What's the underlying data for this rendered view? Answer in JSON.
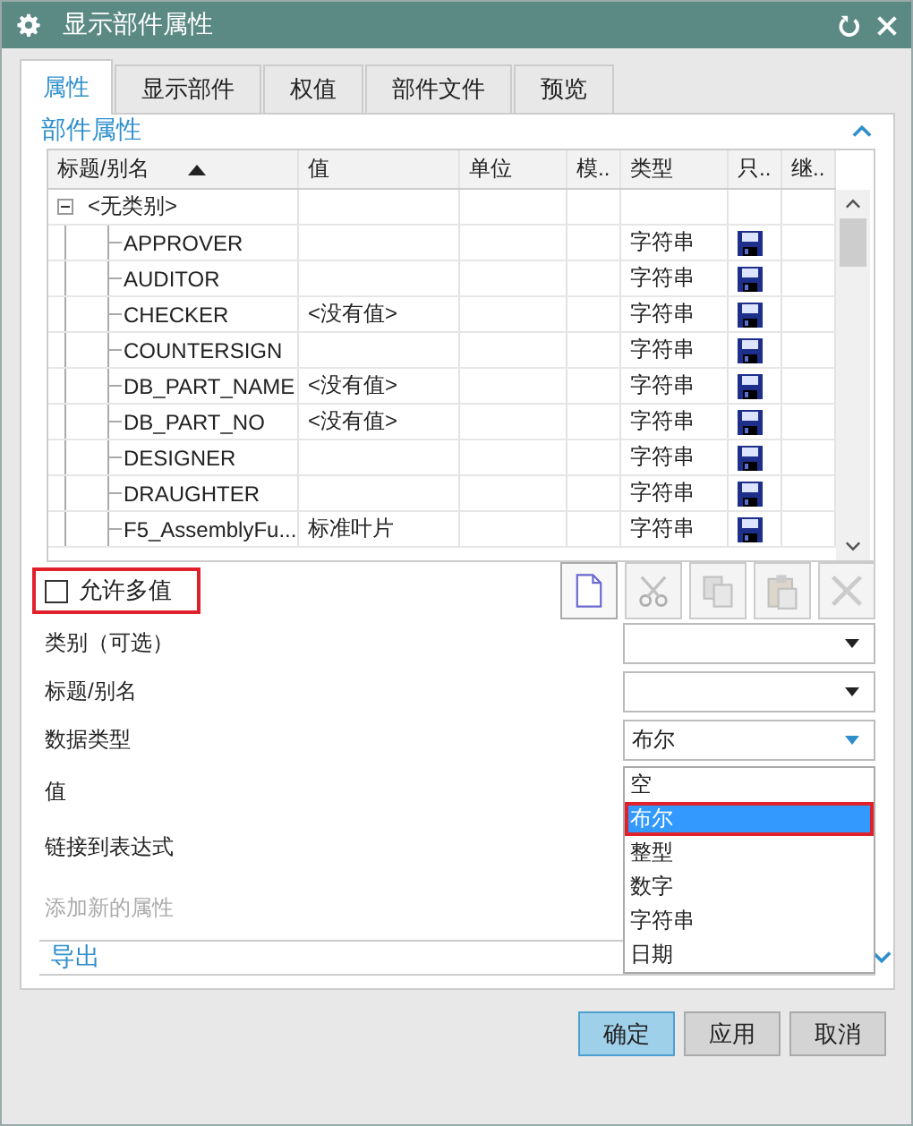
{
  "window": {
    "title": "显示部件属性"
  },
  "tabs": [
    {
      "label": "属性",
      "selected": true
    },
    {
      "label": "显示部件",
      "selected": false
    },
    {
      "label": "权值",
      "selected": false
    },
    {
      "label": "部件文件",
      "selected": false
    },
    {
      "label": "预览",
      "selected": false
    }
  ],
  "section": {
    "title": "部件属性",
    "expanded": true
  },
  "table": {
    "columns": [
      "标题/别名",
      "值",
      "单位",
      "模..",
      "类型",
      "只..",
      "继.."
    ],
    "group": {
      "label": "<无类别>",
      "expanded": true
    },
    "rows": [
      {
        "title": "APPROVER",
        "type": "字符串",
        "read_only": true
      },
      {
        "title": "AUDITOR",
        "type": "字符串",
        "read_only": true
      },
      {
        "title": "CHECKER",
        "value": "<没有值>",
        "type": "字符串",
        "read_only": true
      },
      {
        "title": "COUNTERSIGN",
        "type": "字符串",
        "read_only": true
      },
      {
        "title": "DB_PART_NAME",
        "value": "<没有值>",
        "type": "字符串",
        "read_only": true
      },
      {
        "title": "DB_PART_NO",
        "value": "<没有值>",
        "type": "字符串",
        "read_only": true
      },
      {
        "title": "DESIGNER",
        "type": "字符串",
        "read_only": true
      },
      {
        "title": "DRAUGHTER",
        "type": "字符串",
        "read_only": true
      },
      {
        "title": "F5_AssemblyFu...",
        "value": "标准叶片",
        "type": "字符串",
        "read_only": true
      }
    ]
  },
  "allow_multiple": {
    "label": "允许多值",
    "checked": false,
    "highlighted": true
  },
  "toolbar": [
    {
      "kind": "new",
      "disabled": false
    },
    {
      "kind": "cut",
      "disabled": true
    },
    {
      "kind": "copy",
      "disabled": true
    },
    {
      "kind": "paste",
      "disabled": true
    },
    {
      "kind": "delete",
      "disabled": true
    }
  ],
  "fields": [
    {
      "label": "类别（可选）",
      "kind": "combo"
    },
    {
      "label": "标题/别名",
      "kind": "combo"
    },
    {
      "label": "数据类型",
      "kind": "combo",
      "value": "布尔",
      "open": true
    },
    {
      "label": "值",
      "kind": "plain"
    },
    {
      "label": "链接到表达式",
      "kind": "plain"
    },
    {
      "label": "添加新的属性",
      "kind": "disabled"
    }
  ],
  "dropdown": [
    {
      "label": "空",
      "selected": false
    },
    {
      "label": "布尔",
      "selected": true
    },
    {
      "label": "整型",
      "selected": false
    },
    {
      "label": "数字",
      "selected": false
    },
    {
      "label": "字符串",
      "selected": false
    },
    {
      "label": "日期",
      "selected": false
    }
  ],
  "export_section": {
    "title": "导出",
    "expanded": false
  },
  "buttons": [
    {
      "label": "确定",
      "default": true
    },
    {
      "label": "应用",
      "default": false
    },
    {
      "label": "取消",
      "default": false
    }
  ]
}
